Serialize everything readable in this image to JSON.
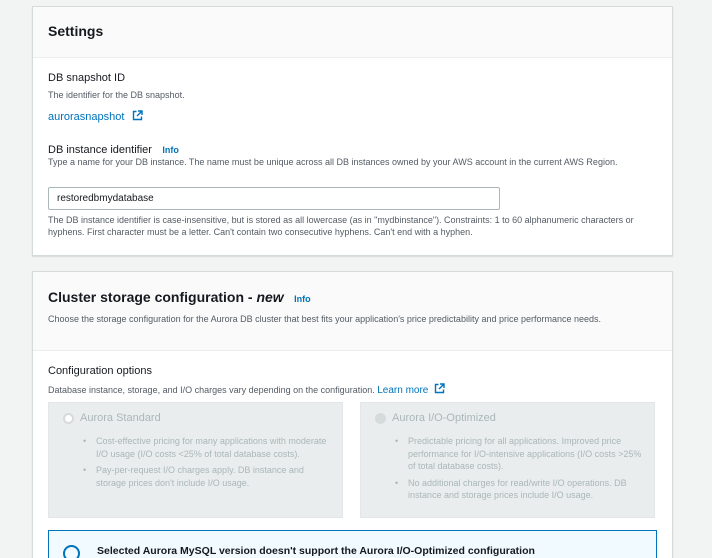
{
  "settings": {
    "title": "Settings",
    "snapshot_label": "DB snapshot ID",
    "snapshot_desc": "The identifier for the DB snapshot.",
    "snapshot_link": "aurorasnapshot",
    "instance_label": "DB instance identifier",
    "info": "Info",
    "instance_desc": "Type a name for your DB instance. The name must be unique across all DB instances owned by your AWS account in the current AWS Region.",
    "instance_value": "restoredbmydatabase",
    "instance_hint": "The DB instance identifier is case-insensitive, but is stored as all lowercase (as in \"mydbinstance\"). Constraints: 1 to 60 alphanumeric characters or hyphens. First character must be a letter. Can't contain two consecutive hyphens. Can't end with a hyphen."
  },
  "cluster": {
    "title_main": "Cluster storage configuration - ",
    "title_new": "new",
    "info": "Info",
    "desc": "Choose the storage configuration for the Aurora DB cluster that best fits your application's price predictability and price performance needs.",
    "options_label": "Configuration options",
    "options_desc": "Database instance, storage, and I/O charges vary depending on the configuration. ",
    "learn_more": "Learn more",
    "standard": {
      "title": "Aurora Standard",
      "bullets": [
        "Cost-effective pricing for many applications with moderate I/O usage (I/O costs <25% of total database costs).",
        "Pay-per-request I/O charges apply. DB instance and storage prices don't include I/O usage."
      ]
    },
    "optimized": {
      "title": "Aurora I/O-Optimized",
      "bullets": [
        "Predictable pricing for all applications. Improved price performance for I/O-intensive applications (I/O costs >25% of total database costs).",
        "No additional charges for read/write I/O operations. DB instance and storage prices include I/O usage."
      ]
    },
    "alert": "Selected Aurora MySQL version doesn't support the Aurora I/O-Optimized configuration"
  }
}
